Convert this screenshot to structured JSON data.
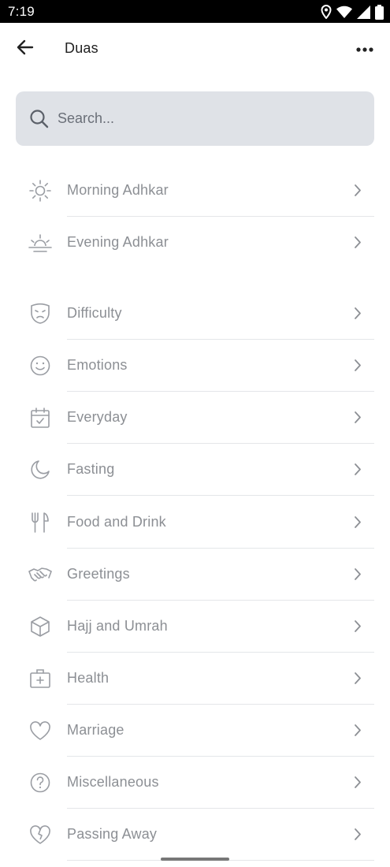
{
  "status_bar": {
    "time": "7:19",
    "icons": [
      "location-icon",
      "wifi-icon",
      "signal-icon",
      "battery-icon"
    ]
  },
  "app_bar": {
    "title": "Duas",
    "back_icon": "arrow-left-icon",
    "more_icon": "more-horizontal-icon"
  },
  "search": {
    "placeholder": "Search...",
    "value": "",
    "icon": "search-icon"
  },
  "sections": [
    {
      "items": [
        {
          "label": "Morning Adhkar",
          "icon": "sun-icon"
        },
        {
          "label": "Evening Adhkar",
          "icon": "sunset-icon"
        }
      ]
    },
    {
      "items": [
        {
          "label": "Difficulty",
          "icon": "sad-mask-icon"
        },
        {
          "label": "Emotions",
          "icon": "smile-icon"
        },
        {
          "label": "Everyday",
          "icon": "calendar-check-icon"
        },
        {
          "label": "Fasting",
          "icon": "moon-icon"
        },
        {
          "label": "Food and Drink",
          "icon": "utensils-icon"
        },
        {
          "label": "Greetings",
          "icon": "handshake-icon"
        },
        {
          "label": "Hajj and Umrah",
          "icon": "cube-icon"
        },
        {
          "label": "Health",
          "icon": "medical-kit-icon"
        },
        {
          "label": "Marriage",
          "icon": "heart-icon"
        },
        {
          "label": "Miscellaneous",
          "icon": "help-circle-icon"
        },
        {
          "label": "Passing Away",
          "icon": "broken-heart-icon"
        }
      ]
    }
  ],
  "colors": {
    "search_bg": "#dfe2e7",
    "label": "#8c8f94",
    "icon": "#9a9da3",
    "divider": "#e4e6e9"
  }
}
